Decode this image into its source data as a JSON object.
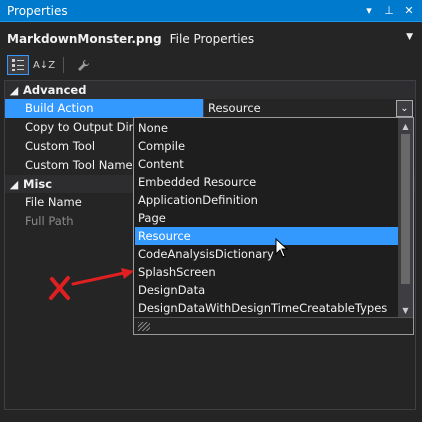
{
  "panel": {
    "title": "Properties",
    "pin_glyph": "▾",
    "autohide_glyph": "⊥",
    "close_glyph": "✕"
  },
  "subject": {
    "object_name": "MarkdownMonster.png",
    "object_kind": "File Properties",
    "dropdown_glyph": "▼"
  },
  "toolbar": {
    "categorized_icon": "categorized-icon",
    "alphabetical_label": "A↓Z",
    "wrench_glyph": "🔧"
  },
  "categories": [
    {
      "label": "Advanced",
      "toggle": "◢"
    },
    {
      "label": "Misc",
      "toggle": "◢"
    }
  ],
  "rows": [
    {
      "name": "Build Action",
      "value": "Resource"
    },
    {
      "name": "Copy to Output Directory",
      "value": ""
    },
    {
      "name": "Custom Tool",
      "value": ""
    },
    {
      "name": "Custom Tool Namespace",
      "value": ""
    },
    {
      "name": "File Name",
      "value": ""
    },
    {
      "name": "Full Path",
      "value": ""
    }
  ],
  "dropdown_button_glyph": "⌄",
  "dropdown": {
    "items": [
      "None",
      "Compile",
      "Content",
      "Embedded Resource",
      "ApplicationDefinition",
      "Page",
      "Resource",
      "CodeAnalysisDictionary",
      "SplashScreen",
      "DesignData",
      "DesignDataWithDesignTimeCreatableTypes"
    ],
    "selected_index": 6,
    "scroll_up_glyph": "▲",
    "scroll_down_glyph": "▼"
  },
  "annotation": {
    "mark_color": "#e02020",
    "arrow_color": "#e02020"
  },
  "colors": {
    "title_bar": "#007acc",
    "selection": "#3399ff",
    "background": "#252526"
  }
}
